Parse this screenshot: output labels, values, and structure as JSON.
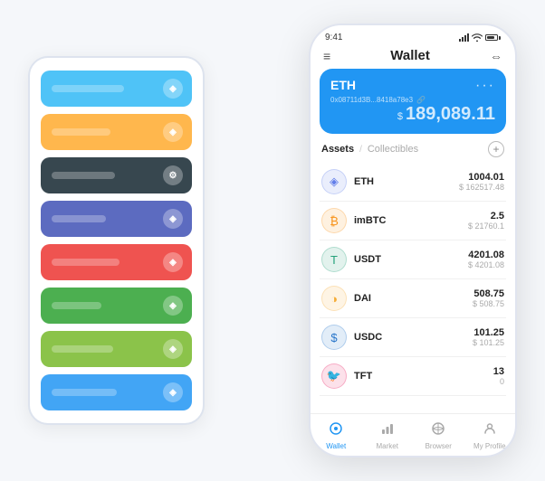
{
  "scene": {
    "background_color": "#f5f7fa"
  },
  "card_stack": {
    "cards": [
      {
        "color": "#4fc3f7",
        "label_width": "80px",
        "icon": "◈",
        "icon_label": "asset-icon-1"
      },
      {
        "color": "#ffb74d",
        "label_width": "65px",
        "icon": "◈",
        "icon_label": "asset-icon-2"
      },
      {
        "color": "#37474f",
        "label_width": "70px",
        "icon": "⚙",
        "icon_label": "asset-icon-3"
      },
      {
        "color": "#5c6bc0",
        "label_width": "60px",
        "icon": "◈",
        "icon_label": "asset-icon-4"
      },
      {
        "color": "#ef5350",
        "label_width": "75px",
        "icon": "◈",
        "icon_label": "asset-icon-5"
      },
      {
        "color": "#4caf50",
        "label_width": "55px",
        "icon": "◈",
        "icon_label": "asset-icon-6"
      },
      {
        "color": "#8bc34a",
        "label_width": "68px",
        "icon": "◈",
        "icon_label": "asset-icon-7"
      },
      {
        "color": "#42a5f5",
        "label_width": "72px",
        "icon": "◈",
        "icon_label": "asset-icon-8"
      }
    ]
  },
  "phone": {
    "status_bar": {
      "time": "9:41",
      "signal": "●●●",
      "wifi": "WiFi",
      "battery": "100"
    },
    "header": {
      "title": "Wallet",
      "menu_icon": "≡",
      "expand_icon": "⇔"
    },
    "eth_card": {
      "name": "ETH",
      "address": "0x08711d3B...8418a78e3",
      "more_icon": "···",
      "balance_label": "$",
      "balance": "189,089.11"
    },
    "assets_section": {
      "active_tab": "Assets",
      "divider": "/",
      "inactive_tab": "Collectibles",
      "add_icon": "+"
    },
    "assets": [
      {
        "symbol": "ETH",
        "icon_color": "#627eea",
        "icon_char": "◈",
        "amount": "1004.01",
        "usd": "$ 162517.48"
      },
      {
        "symbol": "imBTC",
        "icon_color": "#f7931a",
        "icon_char": "₿",
        "amount": "2.5",
        "usd": "$ 21760.1"
      },
      {
        "symbol": "USDT",
        "icon_color": "#26a17b",
        "icon_char": "T",
        "amount": "4201.08",
        "usd": "$ 4201.08"
      },
      {
        "symbol": "DAI",
        "icon_color": "#f5ac37",
        "icon_char": "◑",
        "amount": "508.75",
        "usd": "$ 508.75"
      },
      {
        "symbol": "USDC",
        "icon_color": "#2775ca",
        "icon_char": "$",
        "amount": "101.25",
        "usd": "$ 101.25"
      },
      {
        "symbol": "TFT",
        "icon_color": "#e91e63",
        "icon_char": "🐦",
        "amount": "13",
        "usd": "0"
      }
    ],
    "bottom_nav": [
      {
        "label": "Wallet",
        "icon": "◎",
        "active": true
      },
      {
        "label": "Market",
        "icon": "📊",
        "active": false
      },
      {
        "label": "Browser",
        "icon": "🌐",
        "active": false
      },
      {
        "label": "My Profile",
        "icon": "👤",
        "active": false
      }
    ]
  }
}
